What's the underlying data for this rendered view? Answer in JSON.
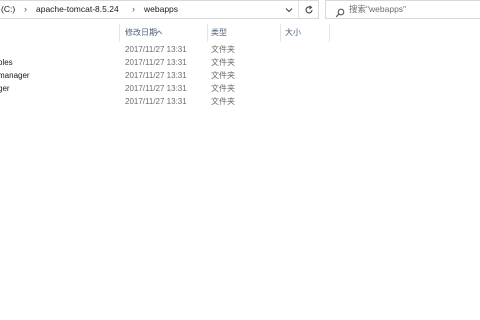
{
  "address_bar": {
    "crumbs": [
      "(C:)",
      "apache-tomcat-8.5.24",
      "webapps"
    ],
    "separator": "›"
  },
  "search": {
    "placeholder": "搜索\"webapps\""
  },
  "columns": {
    "modified": "修改日期",
    "type": "类型",
    "size": "大小"
  },
  "files": [
    {
      "name": "",
      "modified": "2017/11/27 13:31",
      "type": "文件夹"
    },
    {
      "name": "ples",
      "modified": "2017/11/27 13:31",
      "type": "文件夹"
    },
    {
      "name": "manager",
      "modified": "2017/11/27 13:31",
      "type": "文件夹"
    },
    {
      "name": "ger",
      "modified": "2017/11/27 13:31",
      "type": "文件夹"
    },
    {
      "name": "",
      "modified": "2017/11/27 13:31",
      "type": "文件夹"
    }
  ],
  "icons": [
    "chevron-down-icon",
    "refresh-icon",
    "search-icon",
    "sort-chevron-icon"
  ]
}
